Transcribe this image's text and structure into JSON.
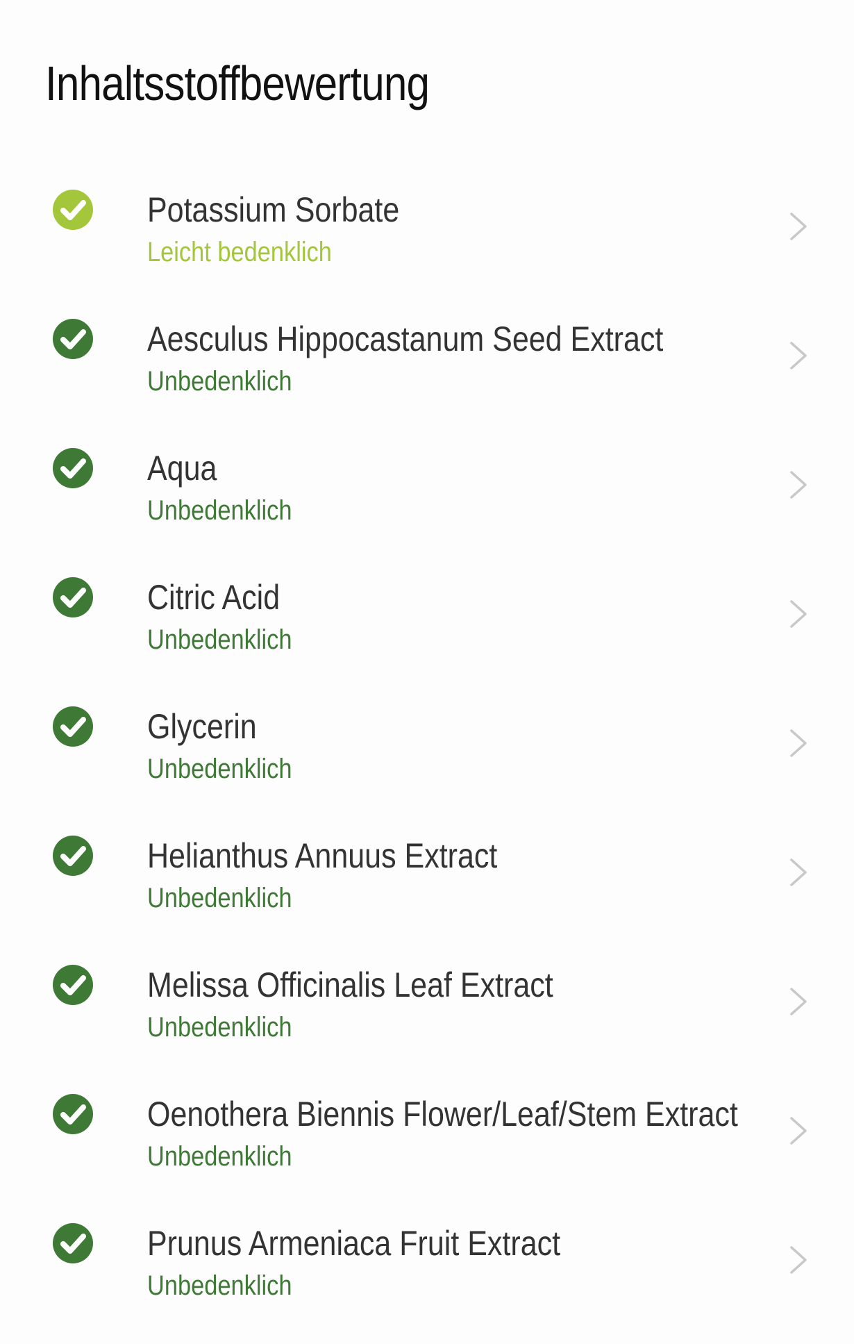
{
  "page": {
    "title": "Inhaltsstoffbewertung"
  },
  "colors": {
    "light_concern": "#A4C63A",
    "harmless": "#3E7A35",
    "chevron": "#C8C8C8"
  },
  "ingredients": [
    {
      "name": "Potassium Sorbate",
      "rating": "Leicht bedenklich",
      "level": "light_concern",
      "icon": "check-circle-icon"
    },
    {
      "name": "Aesculus Hippocastanum Seed Extract",
      "rating": "Unbedenklich",
      "level": "harmless",
      "icon": "check-circle-icon"
    },
    {
      "name": "Aqua",
      "rating": "Unbedenklich",
      "level": "harmless",
      "icon": "check-circle-icon"
    },
    {
      "name": "Citric Acid",
      "rating": "Unbedenklich",
      "level": "harmless",
      "icon": "check-circle-icon"
    },
    {
      "name": "Glycerin",
      "rating": "Unbedenklich",
      "level": "harmless",
      "icon": "check-circle-icon"
    },
    {
      "name": "Helianthus Annuus Extract",
      "rating": "Unbedenklich",
      "level": "harmless",
      "icon": "check-circle-icon"
    },
    {
      "name": "Melissa Officinalis Leaf Extract",
      "rating": "Unbedenklich",
      "level": "harmless",
      "icon": "check-circle-icon"
    },
    {
      "name": "Oenothera Biennis Flower/Leaf/Stem Extract",
      "rating": "Unbedenklich",
      "level": "harmless",
      "icon": "check-circle-icon"
    },
    {
      "name": "Prunus Armeniaca Fruit Extract",
      "rating": "Unbedenklich",
      "level": "harmless",
      "icon": "check-circle-icon"
    }
  ]
}
